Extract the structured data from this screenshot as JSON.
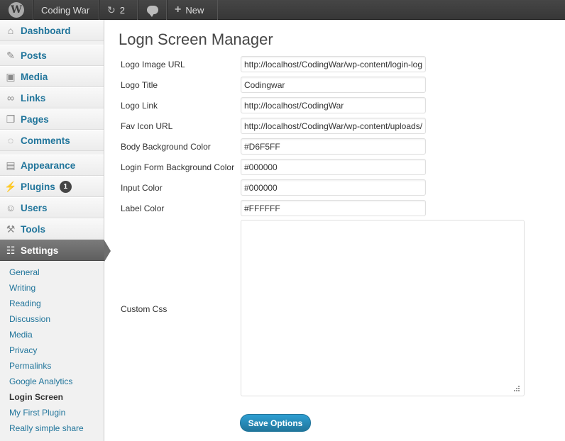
{
  "adminbar": {
    "site_name": "Coding War",
    "updates_count": "2",
    "new_label": "New"
  },
  "sidebar": {
    "items": [
      {
        "label": "Dashboard",
        "icon": "house-icon"
      },
      {
        "label": "Posts",
        "icon": "pushpin-icon"
      },
      {
        "label": "Media",
        "icon": "media-icon"
      },
      {
        "label": "Links",
        "icon": "link-icon"
      },
      {
        "label": "Pages",
        "icon": "pages-icon"
      },
      {
        "label": "Comments",
        "icon": "comment-icon"
      },
      {
        "label": "Appearance",
        "icon": "appearance-icon"
      },
      {
        "label": "Plugins",
        "icon": "plug-icon",
        "badge": "1"
      },
      {
        "label": "Users",
        "icon": "users-icon"
      },
      {
        "label": "Tools",
        "icon": "tools-icon"
      },
      {
        "label": "Settings",
        "icon": "settings-icon"
      }
    ],
    "submenu": [
      "General",
      "Writing",
      "Reading",
      "Discussion",
      "Media",
      "Privacy",
      "Permalinks",
      "Google Analytics",
      "Login Screen",
      "My First Plugin",
      "Really simple share"
    ],
    "current_submenu": "Login Screen"
  },
  "page": {
    "title": "Logn Screen Manager",
    "fields": [
      {
        "label": "Logo Image URL",
        "value": "http://localhost/CodingWar/wp-content/login-logo.png"
      },
      {
        "label": "Logo Title",
        "value": "Codingwar"
      },
      {
        "label": "Logo Link",
        "value": "http://localhost/CodingWar"
      },
      {
        "label": "Fav Icon URL",
        "value": "http://localhost/CodingWar/wp-content/uploads/favicon.ico"
      },
      {
        "label": "Body Background Color",
        "value": "#D6F5FF"
      },
      {
        "label": "Login Form Background Color",
        "value": "#000000"
      },
      {
        "label": "Input Color",
        "value": "#000000"
      },
      {
        "label": "Label Color",
        "value": "#FFFFFF"
      }
    ],
    "custom_css_label": "Custom Css",
    "custom_css_value": "",
    "save_label": "Save Options"
  },
  "colors": {
    "link": "#21759b",
    "adminbar_bg": "#464646",
    "button": "#21759b"
  }
}
